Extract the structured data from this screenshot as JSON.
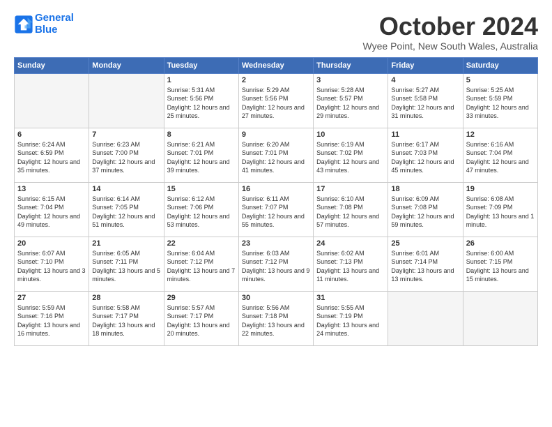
{
  "header": {
    "logo_line1": "General",
    "logo_line2": "Blue",
    "title": "October 2024",
    "subtitle": "Wyee Point, New South Wales, Australia"
  },
  "weekdays": [
    "Sunday",
    "Monday",
    "Tuesday",
    "Wednesday",
    "Thursday",
    "Friday",
    "Saturday"
  ],
  "weeks": [
    [
      {
        "day": "",
        "empty": true
      },
      {
        "day": "",
        "empty": true
      },
      {
        "day": "1",
        "sunrise": "Sunrise: 5:31 AM",
        "sunset": "Sunset: 5:56 PM",
        "daylight": "Daylight: 12 hours and 25 minutes."
      },
      {
        "day": "2",
        "sunrise": "Sunrise: 5:29 AM",
        "sunset": "Sunset: 5:56 PM",
        "daylight": "Daylight: 12 hours and 27 minutes."
      },
      {
        "day": "3",
        "sunrise": "Sunrise: 5:28 AM",
        "sunset": "Sunset: 5:57 PM",
        "daylight": "Daylight: 12 hours and 29 minutes."
      },
      {
        "day": "4",
        "sunrise": "Sunrise: 5:27 AM",
        "sunset": "Sunset: 5:58 PM",
        "daylight": "Daylight: 12 hours and 31 minutes."
      },
      {
        "day": "5",
        "sunrise": "Sunrise: 5:25 AM",
        "sunset": "Sunset: 5:59 PM",
        "daylight": "Daylight: 12 hours and 33 minutes."
      }
    ],
    [
      {
        "day": "6",
        "sunrise": "Sunrise: 6:24 AM",
        "sunset": "Sunset: 6:59 PM",
        "daylight": "Daylight: 12 hours and 35 minutes."
      },
      {
        "day": "7",
        "sunrise": "Sunrise: 6:23 AM",
        "sunset": "Sunset: 7:00 PM",
        "daylight": "Daylight: 12 hours and 37 minutes."
      },
      {
        "day": "8",
        "sunrise": "Sunrise: 6:21 AM",
        "sunset": "Sunset: 7:01 PM",
        "daylight": "Daylight: 12 hours and 39 minutes."
      },
      {
        "day": "9",
        "sunrise": "Sunrise: 6:20 AM",
        "sunset": "Sunset: 7:01 PM",
        "daylight": "Daylight: 12 hours and 41 minutes."
      },
      {
        "day": "10",
        "sunrise": "Sunrise: 6:19 AM",
        "sunset": "Sunset: 7:02 PM",
        "daylight": "Daylight: 12 hours and 43 minutes."
      },
      {
        "day": "11",
        "sunrise": "Sunrise: 6:17 AM",
        "sunset": "Sunset: 7:03 PM",
        "daylight": "Daylight: 12 hours and 45 minutes."
      },
      {
        "day": "12",
        "sunrise": "Sunrise: 6:16 AM",
        "sunset": "Sunset: 7:04 PM",
        "daylight": "Daylight: 12 hours and 47 minutes."
      }
    ],
    [
      {
        "day": "13",
        "sunrise": "Sunrise: 6:15 AM",
        "sunset": "Sunset: 7:04 PM",
        "daylight": "Daylight: 12 hours and 49 minutes."
      },
      {
        "day": "14",
        "sunrise": "Sunrise: 6:14 AM",
        "sunset": "Sunset: 7:05 PM",
        "daylight": "Daylight: 12 hours and 51 minutes."
      },
      {
        "day": "15",
        "sunrise": "Sunrise: 6:12 AM",
        "sunset": "Sunset: 7:06 PM",
        "daylight": "Daylight: 12 hours and 53 minutes."
      },
      {
        "day": "16",
        "sunrise": "Sunrise: 6:11 AM",
        "sunset": "Sunset: 7:07 PM",
        "daylight": "Daylight: 12 hours and 55 minutes."
      },
      {
        "day": "17",
        "sunrise": "Sunrise: 6:10 AM",
        "sunset": "Sunset: 7:08 PM",
        "daylight": "Daylight: 12 hours and 57 minutes."
      },
      {
        "day": "18",
        "sunrise": "Sunrise: 6:09 AM",
        "sunset": "Sunset: 7:08 PM",
        "daylight": "Daylight: 12 hours and 59 minutes."
      },
      {
        "day": "19",
        "sunrise": "Sunrise: 6:08 AM",
        "sunset": "Sunset: 7:09 PM",
        "daylight": "Daylight: 13 hours and 1 minute."
      }
    ],
    [
      {
        "day": "20",
        "sunrise": "Sunrise: 6:07 AM",
        "sunset": "Sunset: 7:10 PM",
        "daylight": "Daylight: 13 hours and 3 minutes."
      },
      {
        "day": "21",
        "sunrise": "Sunrise: 6:05 AM",
        "sunset": "Sunset: 7:11 PM",
        "daylight": "Daylight: 13 hours and 5 minutes."
      },
      {
        "day": "22",
        "sunrise": "Sunrise: 6:04 AM",
        "sunset": "Sunset: 7:12 PM",
        "daylight": "Daylight: 13 hours and 7 minutes."
      },
      {
        "day": "23",
        "sunrise": "Sunrise: 6:03 AM",
        "sunset": "Sunset: 7:12 PM",
        "daylight": "Daylight: 13 hours and 9 minutes."
      },
      {
        "day": "24",
        "sunrise": "Sunrise: 6:02 AM",
        "sunset": "Sunset: 7:13 PM",
        "daylight": "Daylight: 13 hours and 11 minutes."
      },
      {
        "day": "25",
        "sunrise": "Sunrise: 6:01 AM",
        "sunset": "Sunset: 7:14 PM",
        "daylight": "Daylight: 13 hours and 13 minutes."
      },
      {
        "day": "26",
        "sunrise": "Sunrise: 6:00 AM",
        "sunset": "Sunset: 7:15 PM",
        "daylight": "Daylight: 13 hours and 15 minutes."
      }
    ],
    [
      {
        "day": "27",
        "sunrise": "Sunrise: 5:59 AM",
        "sunset": "Sunset: 7:16 PM",
        "daylight": "Daylight: 13 hours and 16 minutes."
      },
      {
        "day": "28",
        "sunrise": "Sunrise: 5:58 AM",
        "sunset": "Sunset: 7:17 PM",
        "daylight": "Daylight: 13 hours and 18 minutes."
      },
      {
        "day": "29",
        "sunrise": "Sunrise: 5:57 AM",
        "sunset": "Sunset: 7:17 PM",
        "daylight": "Daylight: 13 hours and 20 minutes."
      },
      {
        "day": "30",
        "sunrise": "Sunrise: 5:56 AM",
        "sunset": "Sunset: 7:18 PM",
        "daylight": "Daylight: 13 hours and 22 minutes."
      },
      {
        "day": "31",
        "sunrise": "Sunrise: 5:55 AM",
        "sunset": "Sunset: 7:19 PM",
        "daylight": "Daylight: 13 hours and 24 minutes."
      },
      {
        "day": "",
        "empty": true
      },
      {
        "day": "",
        "empty": true
      }
    ]
  ]
}
